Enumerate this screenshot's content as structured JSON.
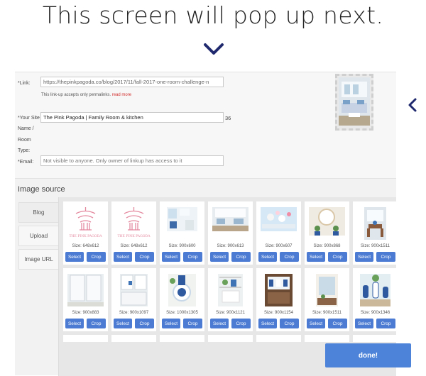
{
  "headline": "This screen will pop up next.",
  "form": {
    "link_label": "*Link:",
    "link_value": "https://thepinkpagoda.co/blog/2017/11/fall-2017-one-room-challenge-n",
    "link_note": "This link-up accepts only permalinks.",
    "read_more": "read more",
    "site_label": "*Your Site",
    "site_value": "The Pink Pagoda | Family Room & kitchen",
    "site_count": "36",
    "name_label": "Name /",
    "room_label": "Room",
    "type_label": "Type:",
    "email_label": "*Email:",
    "email_placeholder": "Not visible to anyone. Only owner of linkup has access to it"
  },
  "image_source": {
    "title": "Image source",
    "tabs": [
      "Blog",
      "Upload",
      "Image URL"
    ]
  },
  "cards": [
    {
      "size": "Size: 648x612",
      "kind": "pagoda",
      "caption": "THE PINK PAGODA"
    },
    {
      "size": "Size: 648x612",
      "kind": "pagoda",
      "caption": "THE PINK PAGODA"
    },
    {
      "size": "Size: 900x600",
      "kind": "room-a"
    },
    {
      "size": "Size: 900x613",
      "kind": "room-b"
    },
    {
      "size": "Size: 900x607",
      "kind": "table"
    },
    {
      "size": "Size: 900x868",
      "kind": "mirror"
    },
    {
      "size": "Size: 900x1511",
      "kind": "dining"
    },
    {
      "size": "Size: 900x883",
      "kind": "cabinet"
    },
    {
      "size": "Size: 900x1097",
      "kind": "cabinet2"
    },
    {
      "size": "Size: 1000x1305",
      "kind": "plates"
    },
    {
      "size": "Size: 900x1121",
      "kind": "shelf"
    },
    {
      "size": "Size: 900x1154",
      "kind": "cabinet3"
    },
    {
      "size": "Size: 900x1511",
      "kind": "door"
    },
    {
      "size": "Size: 900x1346",
      "kind": "vases"
    }
  ],
  "buttons": {
    "select": "Select",
    "crop": "Crop",
    "done": "done!"
  },
  "colors": {
    "accent": "#4b7bd3",
    "done": "#4d84d9",
    "chevron": "#1f2a6e",
    "required": "#c62828"
  },
  "icons": {
    "down": "chevron-down-icon",
    "side": "chevron-left-icon"
  }
}
